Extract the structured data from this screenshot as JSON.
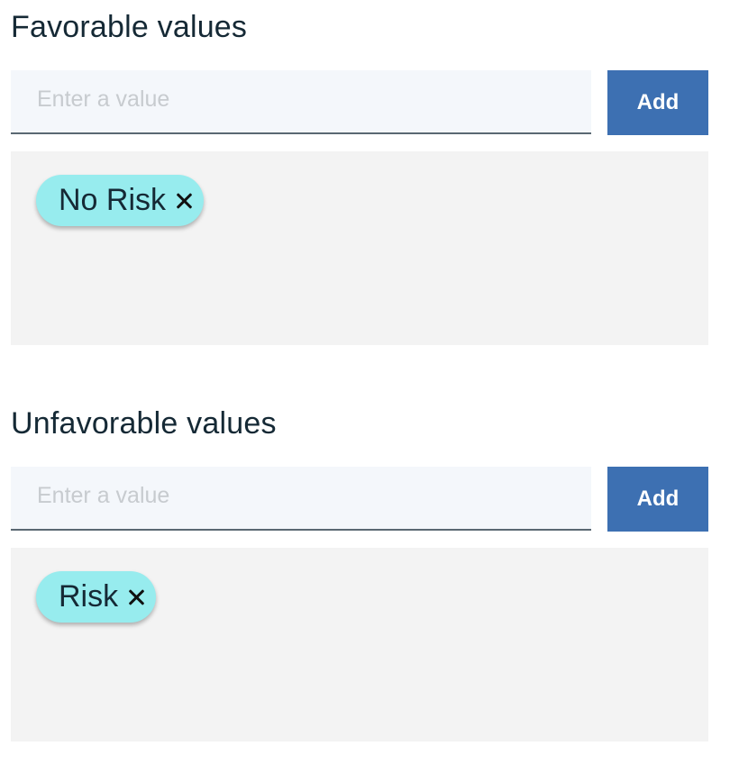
{
  "favorable": {
    "title": "Favorable values",
    "input_placeholder": "Enter a value",
    "input_value": "",
    "add_label": "Add",
    "tags": [
      {
        "label": "No Risk",
        "remove_icon": "close-icon"
      }
    ]
  },
  "unfavorable": {
    "title": "Unfavorable values",
    "input_placeholder": "Enter a value",
    "input_value": "",
    "add_label": "Add",
    "tags": [
      {
        "label": "Risk",
        "remove_icon": "close-icon"
      }
    ]
  },
  "colors": {
    "button": "#3d70b2",
    "input_background": "#f4f7fb",
    "tag_area_background": "#f3f3f3",
    "tag_background": "#97ecee",
    "text": "#152935"
  }
}
